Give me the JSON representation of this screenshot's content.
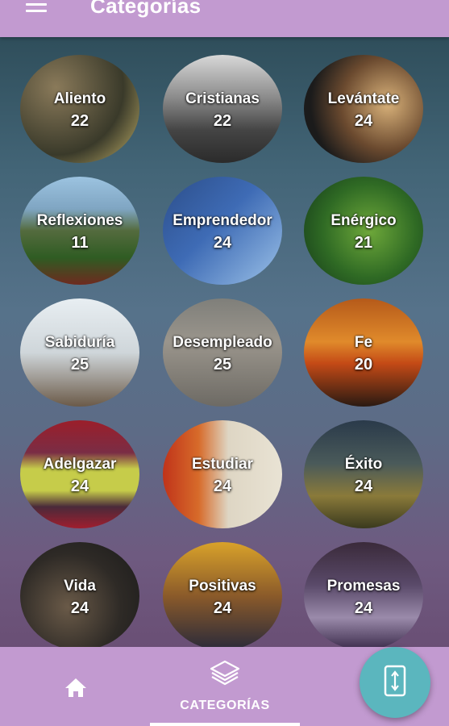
{
  "header": {
    "title": "Categorías"
  },
  "categories": [
    {
      "name": "Aliento",
      "count": "22"
    },
    {
      "name": "Cristianas",
      "count": "22"
    },
    {
      "name": "Levántate",
      "count": "24"
    },
    {
      "name": "Reflexiones",
      "count": "11"
    },
    {
      "name": "Emprendedor",
      "count": "24"
    },
    {
      "name": "Enérgico",
      "count": "21"
    },
    {
      "name": "Sabiduría",
      "count": "25"
    },
    {
      "name": "Desempleado",
      "count": "25"
    },
    {
      "name": "Fe",
      "count": "20"
    },
    {
      "name": "Adelgazar",
      "count": "24"
    },
    {
      "name": "Estudiar",
      "count": "24"
    },
    {
      "name": "Éxito",
      "count": "24"
    },
    {
      "name": "Vida",
      "count": "24"
    },
    {
      "name": "Positivas",
      "count": "24"
    },
    {
      "name": "Promesas",
      "count": "24"
    }
  ],
  "nav": {
    "categories_label": "CATEGORÍAS"
  },
  "colors": {
    "bar": "#c29ad0",
    "fab": "#5bb6be"
  }
}
